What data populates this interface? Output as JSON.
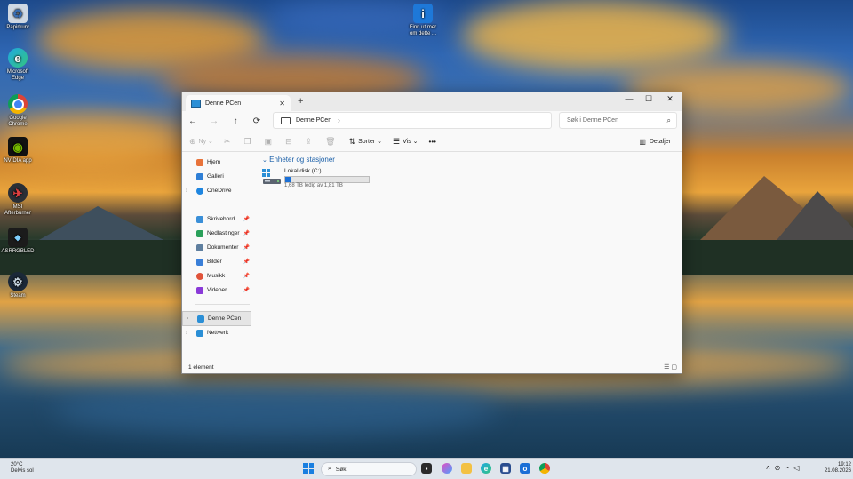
{
  "desktop": {
    "icons": [
      {
        "label": "Papirkurv",
        "icon": "recycle-bin-icon"
      },
      {
        "label": "Microsoft Edge",
        "icon": "edge-icon"
      },
      {
        "label": "Google Chrome",
        "icon": "chrome-icon"
      },
      {
        "label": "NVIDIA app",
        "icon": "nvidia-icon"
      },
      {
        "label": "MSI Afterburner",
        "icon": "afterburner-icon"
      },
      {
        "label": "ASRRGBLED",
        "icon": "asrock-led-icon"
      },
      {
        "label": "Steam",
        "icon": "steam-icon"
      },
      {
        "label": "Finn ut mer om dette ...",
        "icon": "spotlight-icon"
      }
    ]
  },
  "explorer": {
    "tab_title": "Denne PCen",
    "nav": {
      "back": "←",
      "forward": "→",
      "up": "↑",
      "refresh": "⟳"
    },
    "address": {
      "path": "Denne PCen"
    },
    "search": {
      "placeholder": "Søk i Denne PCen"
    },
    "toolbar": {
      "new_label": "Ny",
      "sort_label": "Sorter",
      "view_label": "Vis",
      "more_label": "•••",
      "details_label": "Detaljer"
    },
    "sidebar": {
      "quick": [
        {
          "label": "Hjem",
          "color": "#e8733a"
        },
        {
          "label": "Galleri",
          "color": "#2f7fd6"
        },
        {
          "label": "OneDrive",
          "color": "#1f86e0"
        }
      ],
      "pinned": [
        {
          "label": "Skrivebord",
          "color": "#3a8fd8"
        },
        {
          "label": "Nedlastinger",
          "color": "#2aa05a"
        },
        {
          "label": "Dokumenter",
          "color": "#5f7f9f"
        },
        {
          "label": "Bilder",
          "color": "#3a7fd8"
        },
        {
          "label": "Musikk",
          "color": "#e0533a"
        },
        {
          "label": "Videoer",
          "color": "#8a3ad8"
        }
      ],
      "bottom": [
        {
          "label": "Denne PCen",
          "color": "#2b8fd6"
        },
        {
          "label": "Nettverk",
          "color": "#2b8fd6"
        }
      ]
    },
    "section_title": "Enheter og stasjoner",
    "drive": {
      "name": "Lokal disk (C:)",
      "free_text": "1,68 TB ledig av 1,81 TB",
      "used_fraction": 0.07
    },
    "status": "1 element"
  },
  "taskbar": {
    "weather_temp": "20°C",
    "weather_desc": "Delvis sol",
    "search_placeholder": "Søk",
    "time": "19:12",
    "date": "21.08.2026"
  }
}
